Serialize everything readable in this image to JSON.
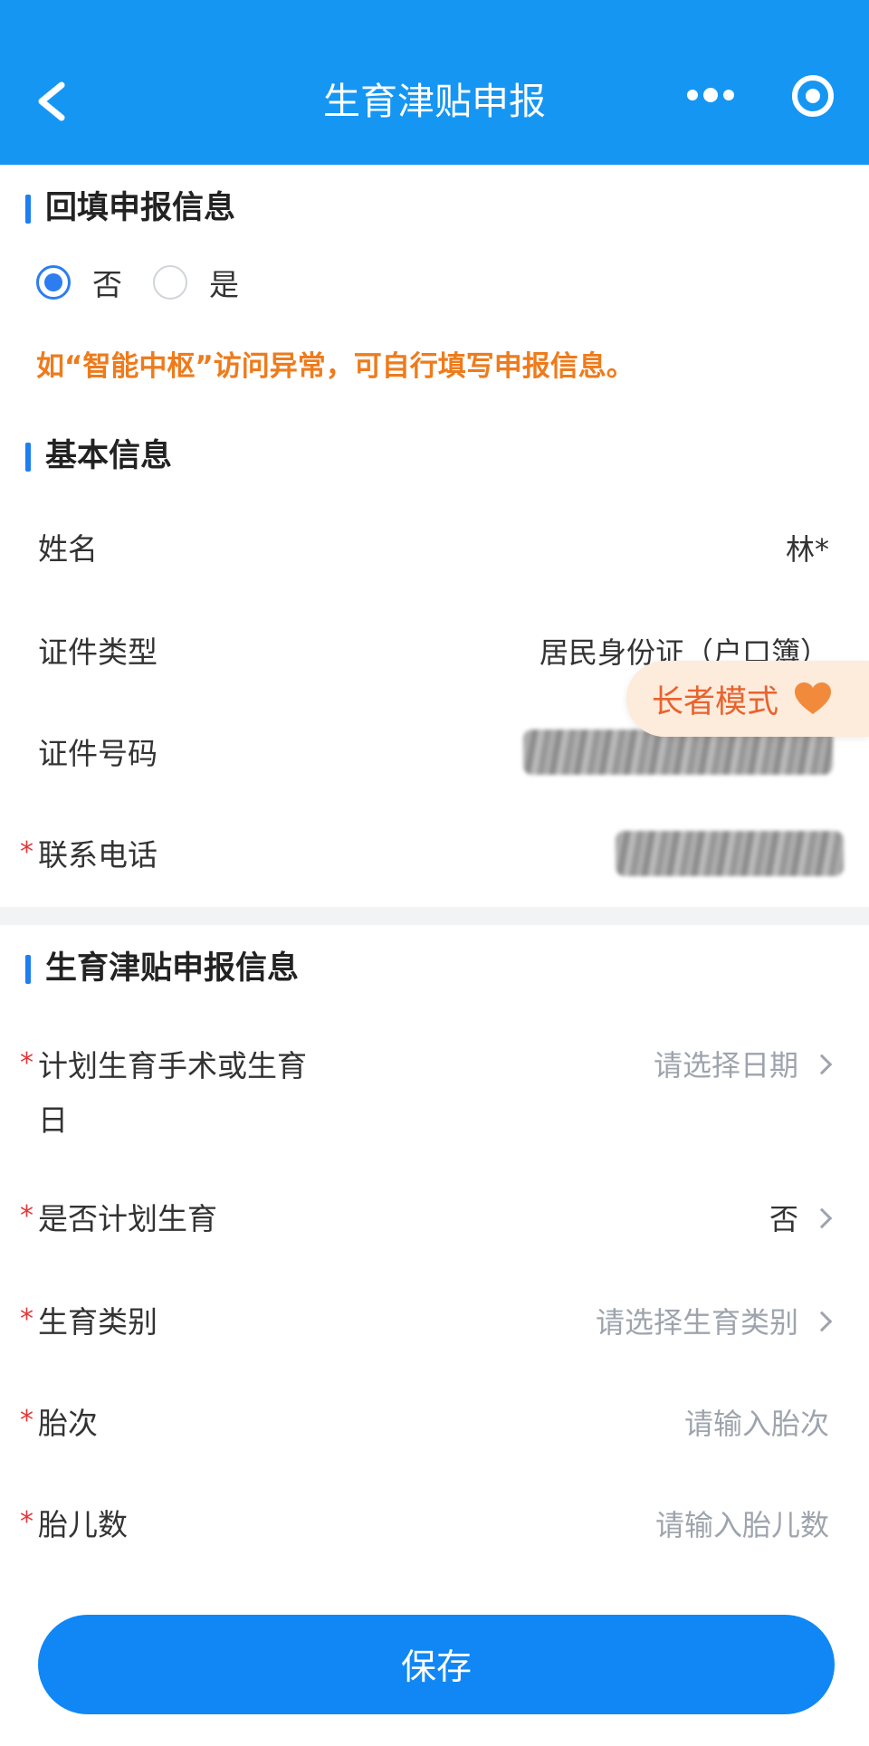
{
  "header": {
    "title": "生育津贴申报"
  },
  "backfill": {
    "title": "回填申报信息",
    "options": [
      {
        "label": "否",
        "selected": true
      },
      {
        "label": "是",
        "selected": false
      }
    ],
    "notice": "如“智能中枢”访问异常，可自行填写申报信息。"
  },
  "basic": {
    "title": "基本信息",
    "name_label": "姓名",
    "name_value": "林*",
    "id_type_label": "证件类型",
    "id_type_value": "居民身份证（户口簿）",
    "id_number_label": "证件号码",
    "phone_label": "联系电话",
    "required_mark": "*"
  },
  "elder_mode": {
    "label": "长者模式"
  },
  "maternity": {
    "title": "生育津贴申报信息",
    "date_label_line1": "计划生育手术或生育",
    "date_label_line2": "日",
    "date_placeholder": "请选择日期",
    "planned_label": "是否计划生育",
    "planned_value": "否",
    "type_label": "生育类别",
    "type_placeholder": "请选择生育类别",
    "parity_label": "胎次",
    "parity_placeholder": "请输入胎次",
    "fetus_label": "胎儿数",
    "fetus_placeholder": "请输入胎儿数"
  },
  "save_label": "保存",
  "colors": {
    "header": "#1596f3",
    "accent": "#1e7ff0",
    "warning": "#ee7b1c",
    "required": "#e2383a"
  }
}
